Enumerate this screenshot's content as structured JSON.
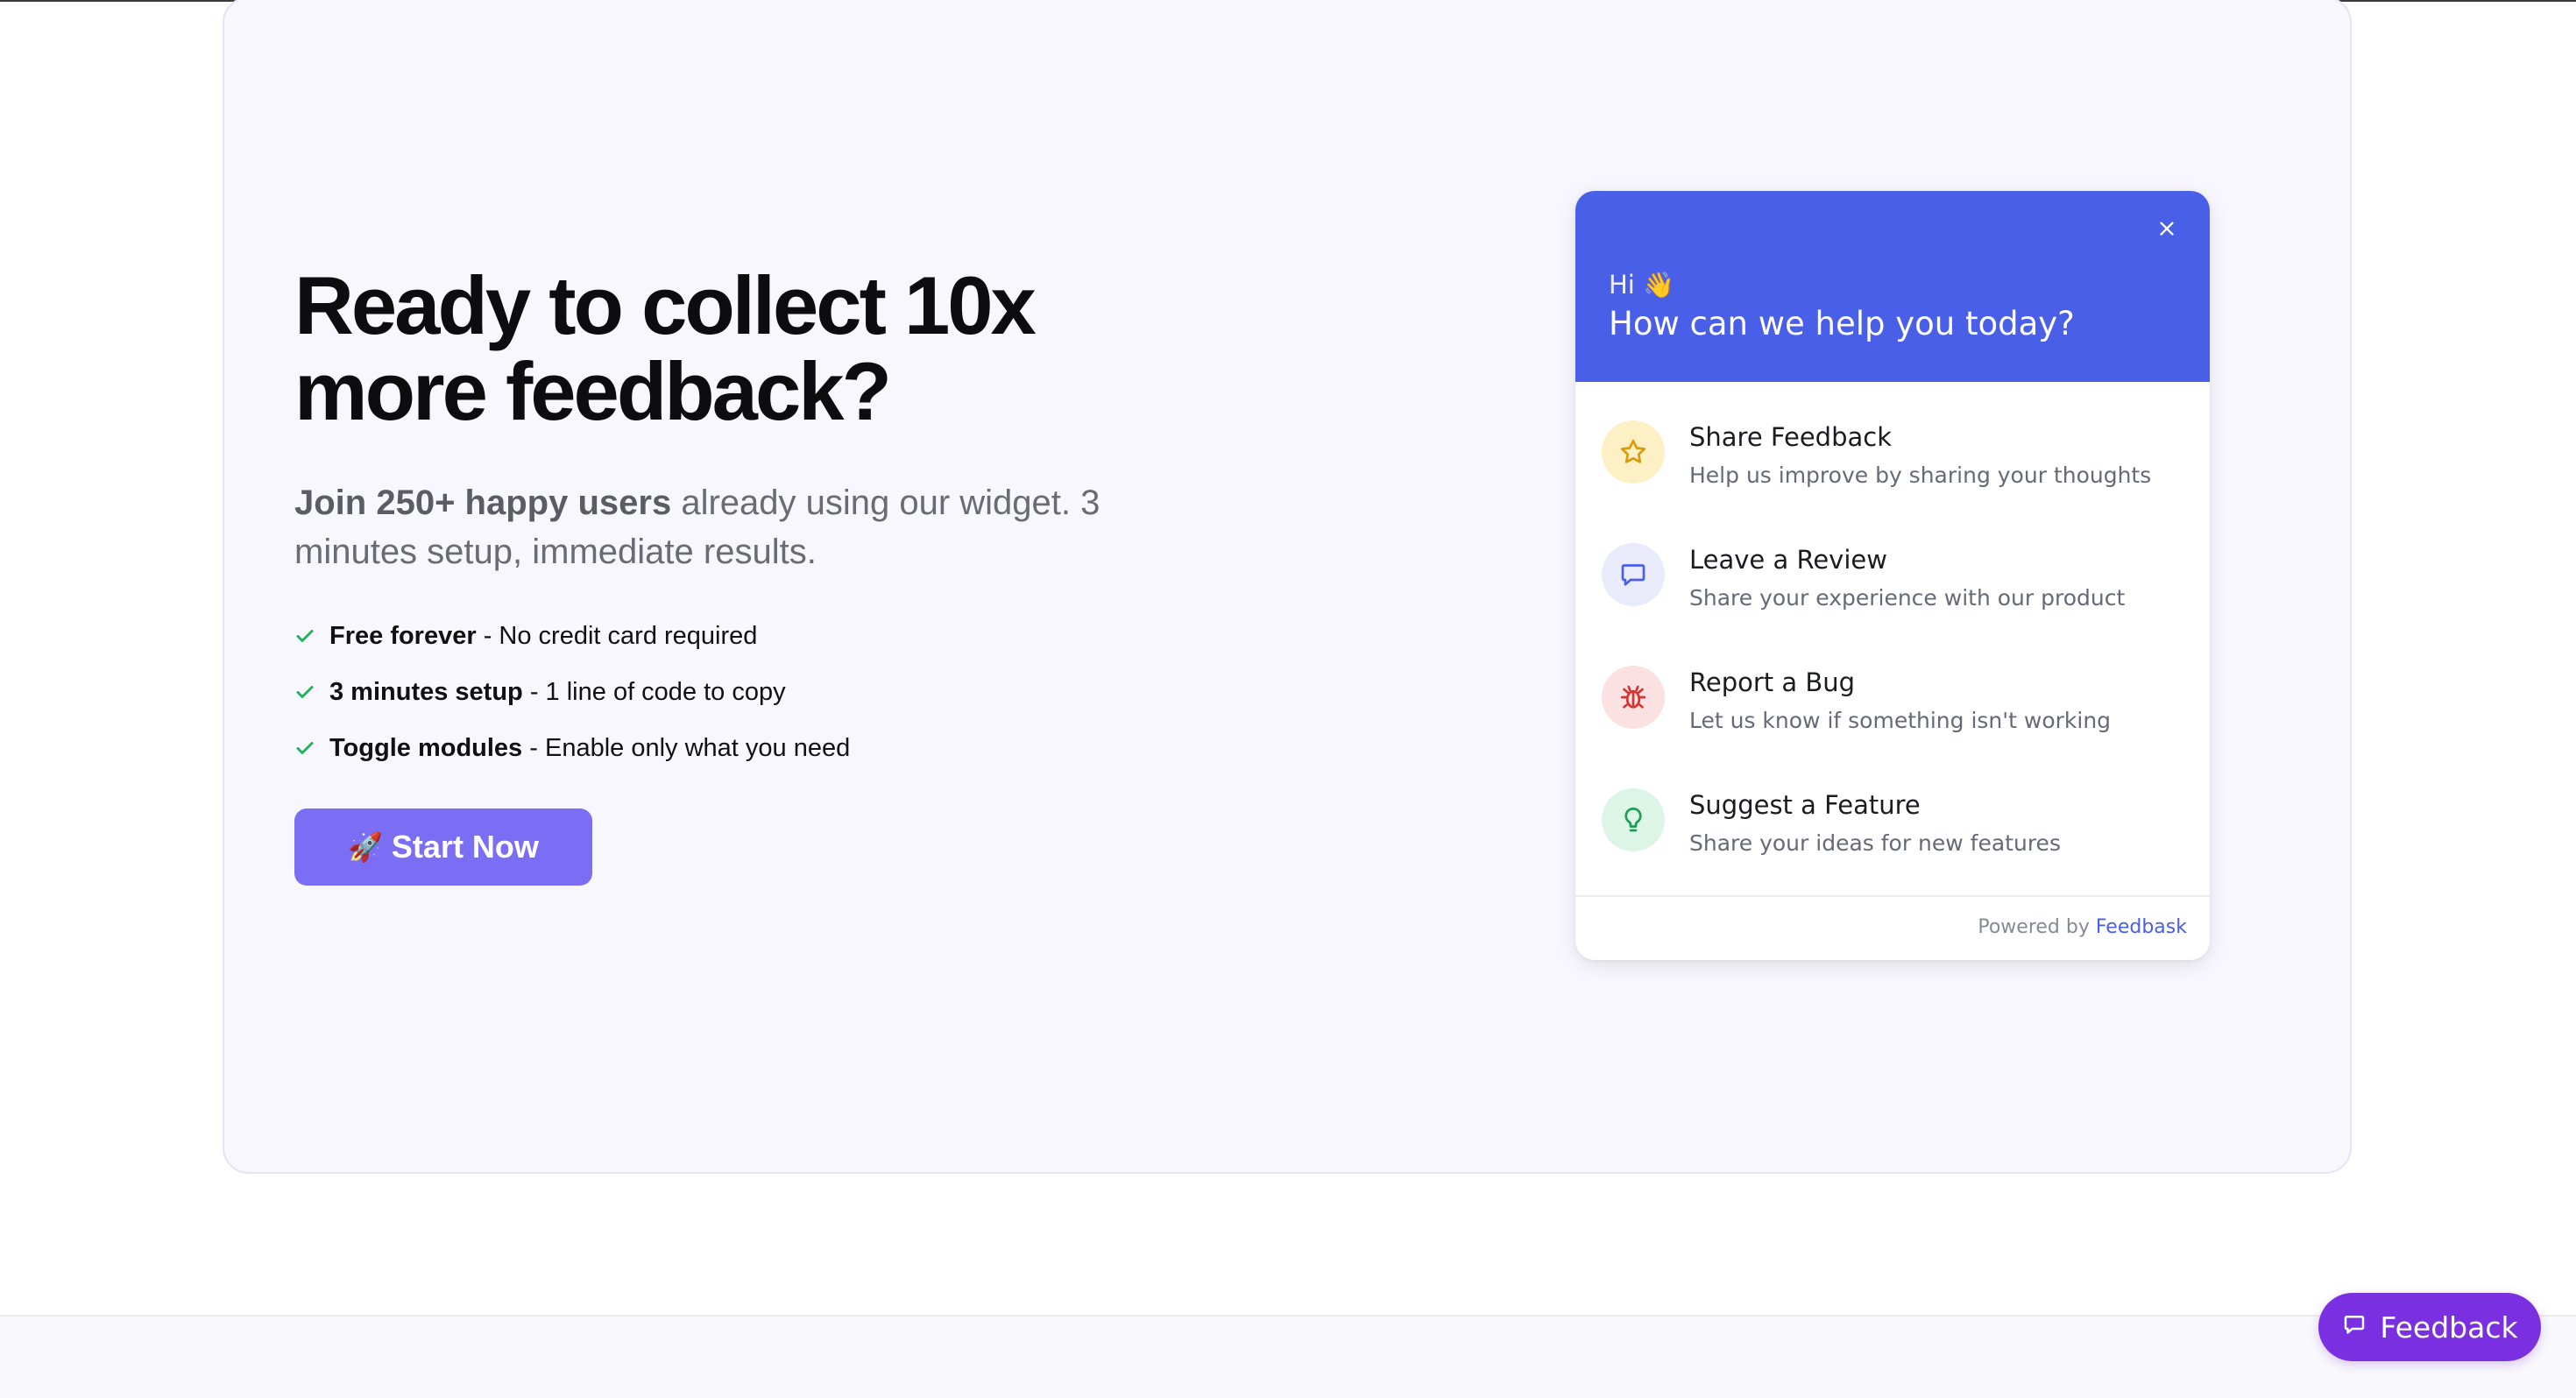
{
  "hero": {
    "headline": "Ready to collect 10x more feedback?",
    "subtext_bold": "Join 250+ happy users",
    "subtext_rest": " already using our widget. 3 minutes setup, immediate results.",
    "features": [
      {
        "bold": "Free forever",
        "rest": " - No credit card required"
      },
      {
        "bold": "3 minutes setup",
        "rest": " - 1 line of code to copy"
      },
      {
        "bold": "Toggle modules",
        "rest": " - Enable only what you need"
      }
    ],
    "cta": {
      "icon": "🚀",
      "label": "Start Now"
    }
  },
  "widget": {
    "greeting": "Hi 👋",
    "title": "How can we help you today?",
    "options": [
      {
        "title": "Share Feedback",
        "desc": "Help us improve by sharing your thoughts",
        "icon": "star-icon"
      },
      {
        "title": "Leave a Review",
        "desc": "Share your experience with our product",
        "icon": "chat-bubble-icon"
      },
      {
        "title": "Report a Bug",
        "desc": "Let us know if something isn't working",
        "icon": "bug-icon"
      },
      {
        "title": "Suggest a Feature",
        "desc": "Share your ideas for new features",
        "icon": "lightbulb-icon"
      }
    ],
    "powered_prefix": "Powered by ",
    "powered_brand": "Feedbask"
  },
  "floating_button": {
    "label": "Feedback",
    "icon": "chat-bubble-icon"
  },
  "colors": {
    "widget_header": "#4a5fe8",
    "cta": "#7b6ef5",
    "floating_button": "#7a2fe0",
    "check": "#22b45a"
  }
}
